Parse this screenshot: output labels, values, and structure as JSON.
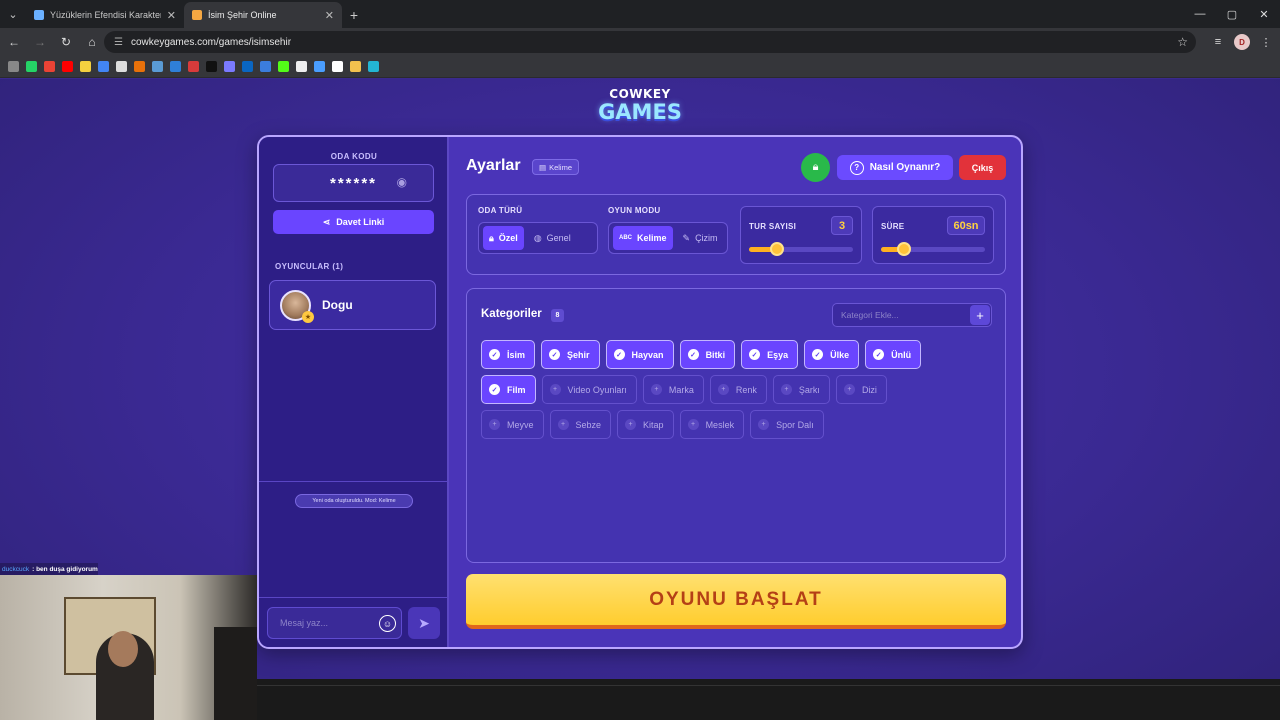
{
  "browser": {
    "tabs": [
      {
        "title": "Yüzüklerin Efendisi Karakterleri",
        "active": false
      },
      {
        "title": "İsim Şehir Online",
        "active": true
      }
    ],
    "url": "cowkeygames.com/games/isimsehir",
    "profile_initial": "D"
  },
  "logo": {
    "line1": "COWKEY",
    "line2": "GAMES"
  },
  "room": {
    "code_label": "ODA KODU",
    "code_masked": "******",
    "invite_label": "Davet Linki",
    "players_label": "OYUNCULAR (1)",
    "players": [
      {
        "name": "Dogu"
      }
    ],
    "system_message": "Yeni oda oluşturuldu. Mod: Kelime",
    "chat_placeholder": "Mesaj yaz..."
  },
  "settings": {
    "title": "Ayarlar",
    "mode_badge": "Kelime",
    "howto_label": "Nasıl Oynanır?",
    "exit_label": "Çıkış",
    "room_type": {
      "label": "ODA TÜRÜ",
      "options": [
        "Özel",
        "Genel"
      ],
      "selected": "Özel"
    },
    "game_mode": {
      "label": "OYUN MODU",
      "options": [
        "Kelime",
        "Çizim"
      ],
      "selected": "Kelime"
    },
    "rounds": {
      "label": "TUR SAYISI",
      "value": "3",
      "fraction": 0.2
    },
    "duration": {
      "label": "SÜRE",
      "value": "60sn",
      "fraction": 0.15
    }
  },
  "categories": {
    "title": "Kategoriler",
    "count": "8",
    "add_placeholder": "Kategori Ekle...",
    "rows": [
      [
        {
          "name": "İsim",
          "on": true
        },
        {
          "name": "Şehir",
          "on": true
        },
        {
          "name": "Hayvan",
          "on": true
        },
        {
          "name": "Bitki",
          "on": true
        },
        {
          "name": "Eşya",
          "on": true
        },
        {
          "name": "Ülke",
          "on": true
        },
        {
          "name": "Ünlü",
          "on": true
        }
      ],
      [
        {
          "name": "Film",
          "on": true
        },
        {
          "name": "Video Oyunları",
          "on": false
        },
        {
          "name": "Marka",
          "on": false
        },
        {
          "name": "Renk",
          "on": false
        },
        {
          "name": "Şarkı",
          "on": false
        },
        {
          "name": "Dizi",
          "on": false
        }
      ],
      [
        {
          "name": "Meyve",
          "on": false
        },
        {
          "name": "Sebze",
          "on": false
        },
        {
          "name": "Kitap",
          "on": false
        },
        {
          "name": "Meslek",
          "on": false
        },
        {
          "name": "Spor Dalı",
          "on": false
        }
      ]
    ]
  },
  "start_label": "OYUNU BAŞLAT",
  "stream_chat": {
    "user": "duckcuck",
    "message": ": ben duşa gidiyorum"
  },
  "colors": {
    "accent": "#6a45ff",
    "start": "#ffcd2e",
    "exit": "#e2323a",
    "lock": "#29b94a"
  }
}
